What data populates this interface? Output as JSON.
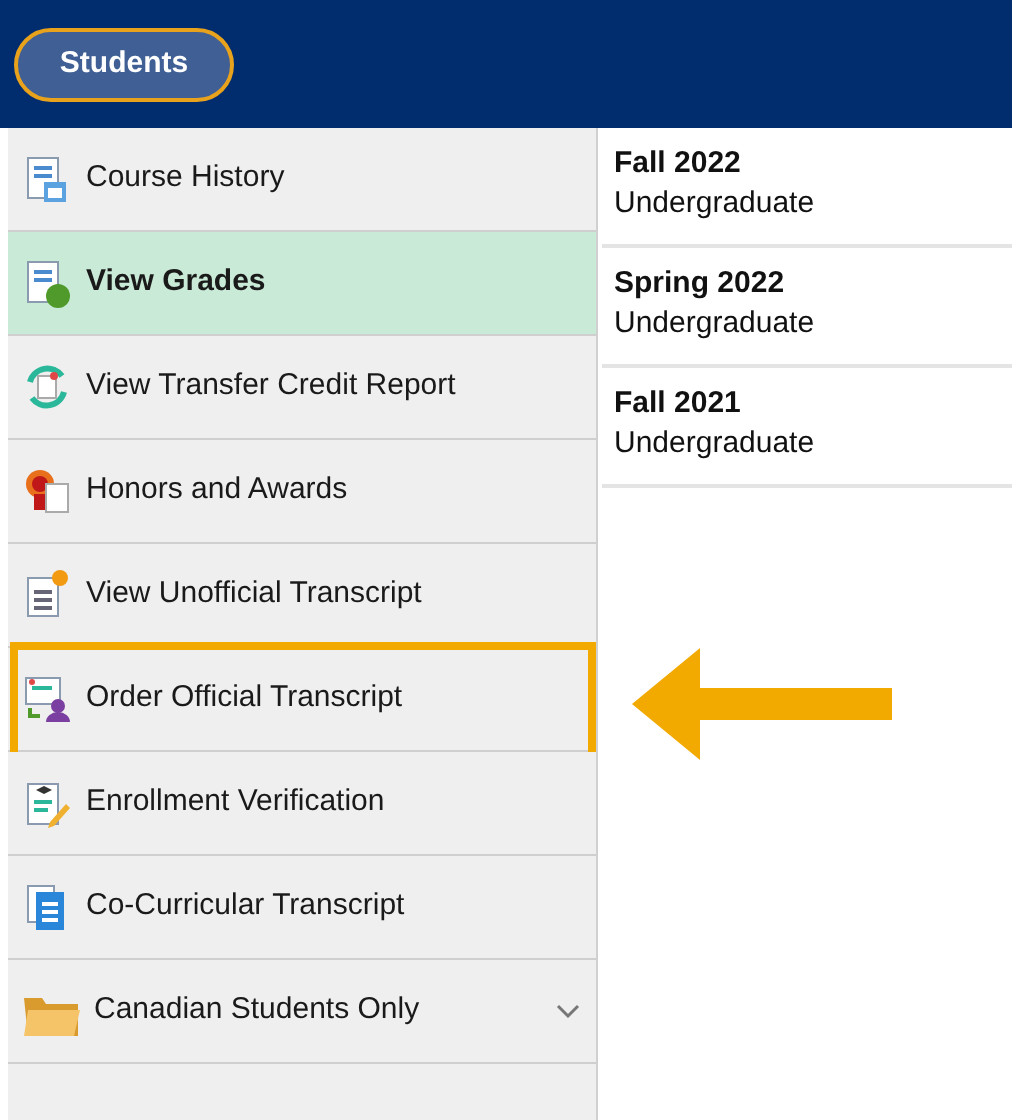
{
  "header": {
    "button": "Students"
  },
  "nav_items": [
    {
      "kind": "link",
      "label": "Course History",
      "selected": false,
      "highlighted": false
    },
    {
      "kind": "link",
      "label": "View Grades",
      "selected": true,
      "highlighted": false
    },
    {
      "kind": "link",
      "label": "View Transfer Credit Report",
      "selected": false,
      "highlighted": false
    },
    {
      "kind": "link",
      "label": "Honors and Awards",
      "selected": false,
      "highlighted": false
    },
    {
      "kind": "link",
      "label": "View Unofficial Transcript",
      "selected": false,
      "highlighted": false
    },
    {
      "kind": "link",
      "label": "Order Official Transcript",
      "selected": false,
      "highlighted": true
    },
    {
      "kind": "link",
      "label": "Enrollment Verification",
      "selected": false,
      "highlighted": false
    },
    {
      "kind": "link",
      "label": "Co-Curricular Transcript",
      "selected": false,
      "highlighted": false
    },
    {
      "kind": "group",
      "label": "Canadian Students Only",
      "selected": false,
      "highlighted": false,
      "expanded": false
    }
  ],
  "terms": [
    {
      "term": "Fall 2022",
      "career": "Undergraduate"
    },
    {
      "term": "Spring 2022",
      "career": "Undergraduate"
    },
    {
      "term": "Fall 2021",
      "career": "Undergraduate"
    }
  ]
}
